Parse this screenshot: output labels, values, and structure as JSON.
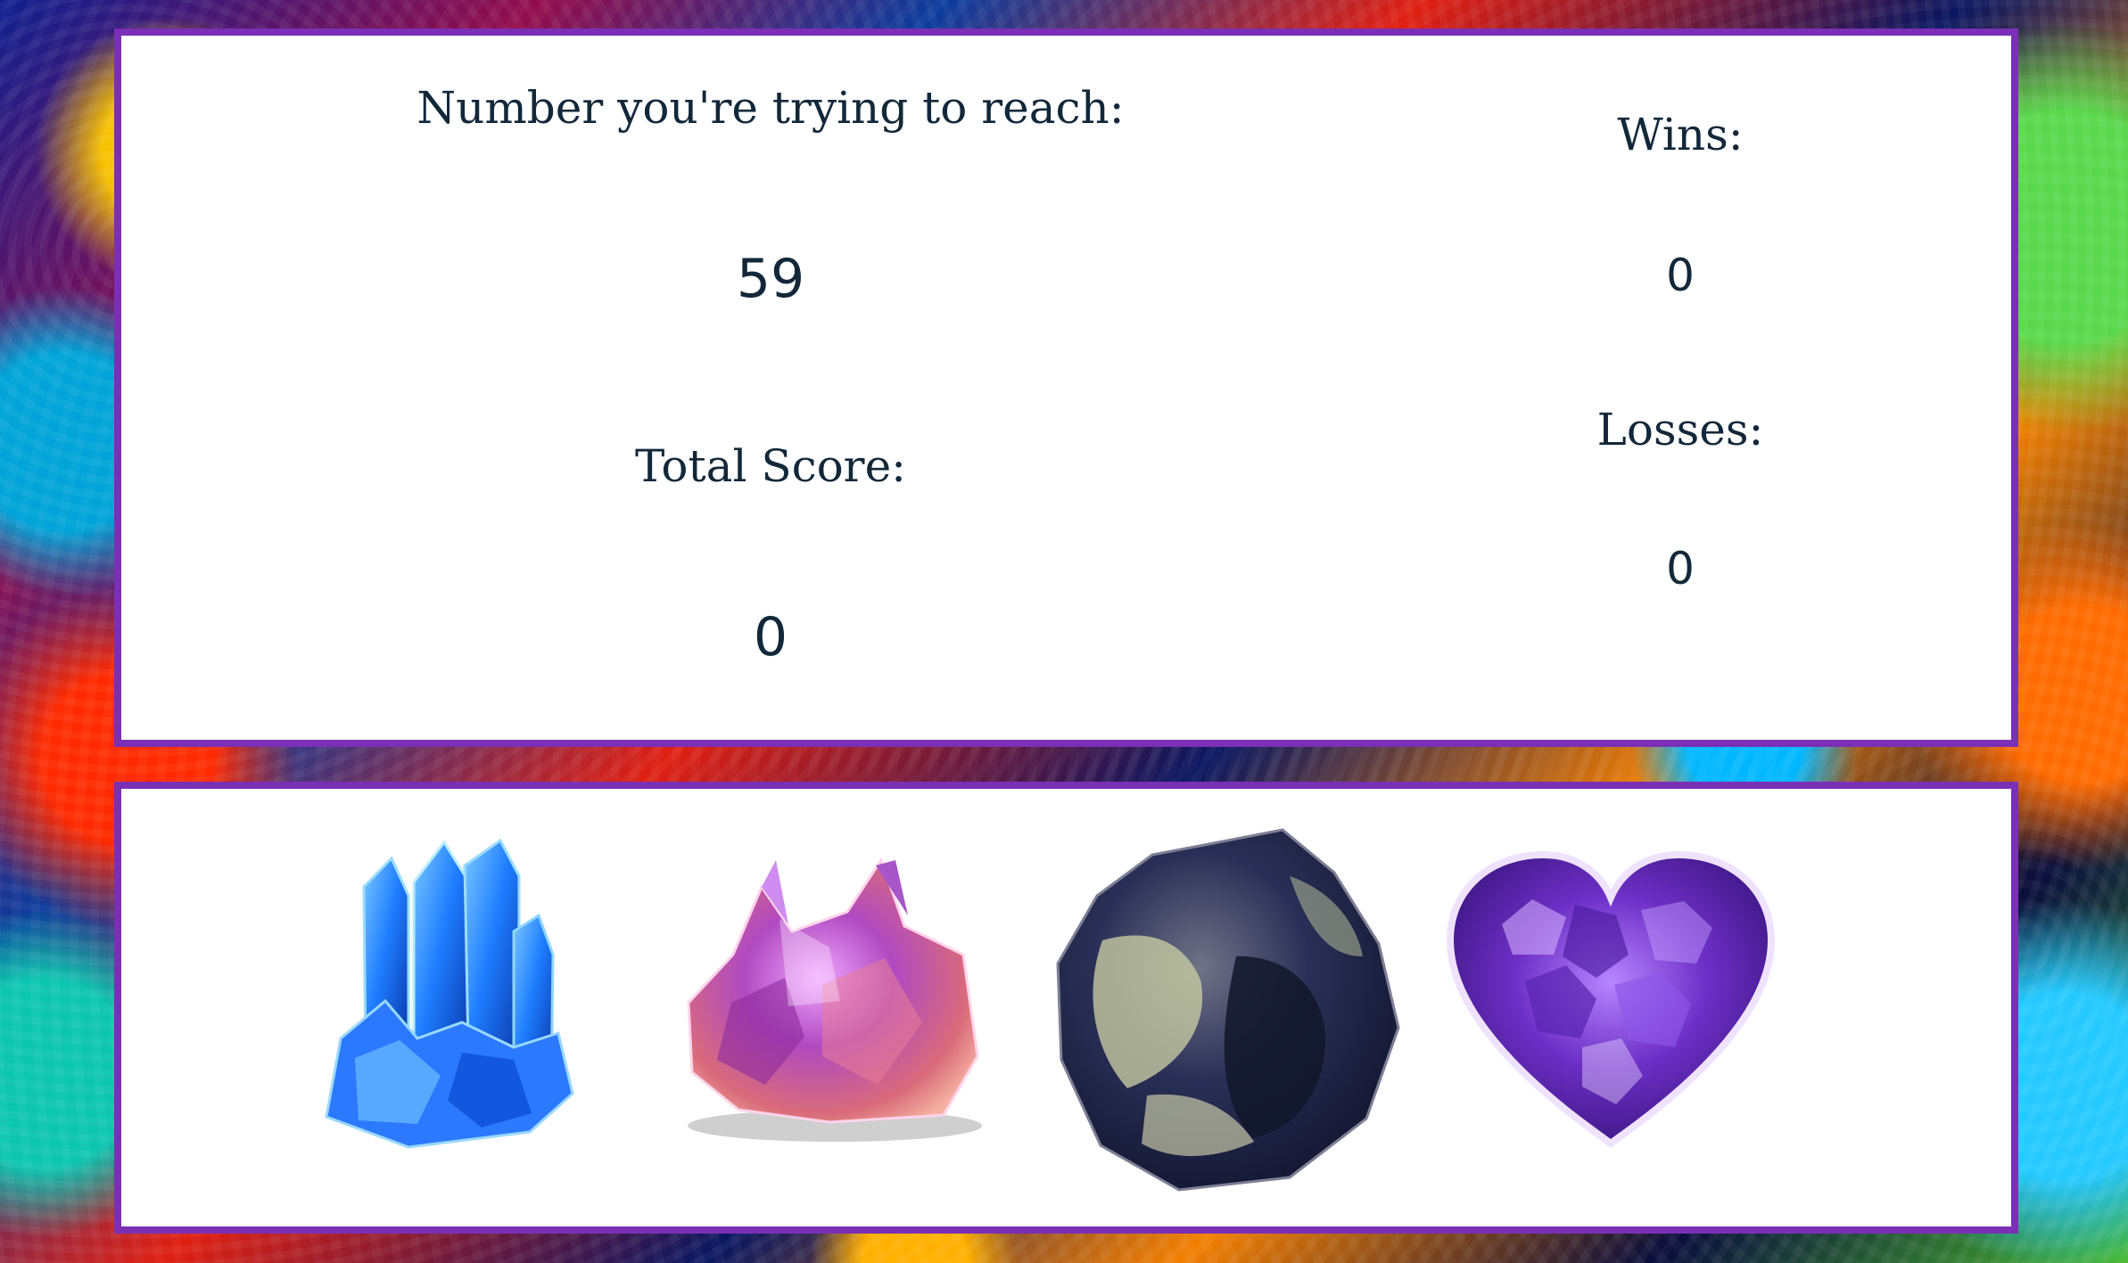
{
  "scoreboard": {
    "target_label": "Number you're trying to reach:",
    "target_value": "59",
    "total_score_label": "Total Score:",
    "total_score_value": "0",
    "wins_label": "Wins:",
    "wins_value": "0",
    "losses_label": "Losses:",
    "losses_value": "0"
  },
  "crystals": [
    {
      "name": "blue-crystal"
    },
    {
      "name": "pink-amethyst-crystal"
    },
    {
      "name": "dark-mineral-rock"
    },
    {
      "name": "purple-amethyst-heart"
    }
  ],
  "colors": {
    "panel_border": "#7b2fb6",
    "panel_background": "#ffffff",
    "text": "#12283a"
  }
}
